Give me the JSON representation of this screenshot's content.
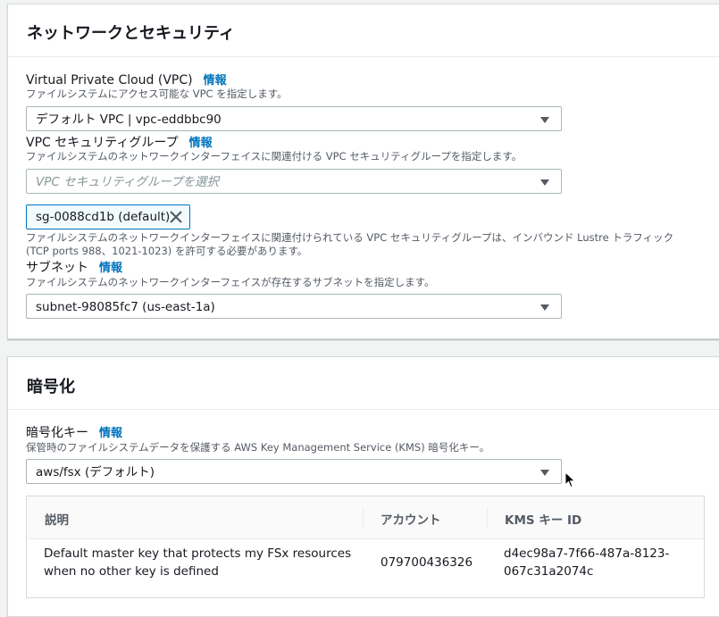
{
  "network": {
    "title": "ネットワークとセキュリティ",
    "vpc": {
      "label": "Virtual Private Cloud (VPC)",
      "info": "情報",
      "description": "ファイルシステムにアクセス可能な VPC を指定します。",
      "value": "デフォルト VPC | vpc-eddbbc90"
    },
    "sg": {
      "label": "VPC セキュリティグループ",
      "info": "情報",
      "description": "ファイルシステムのネットワークインターフェイスに関連付ける VPC セキュリティグループを指定します。",
      "placeholder": "VPC セキュリティグループを選択",
      "token": "sg-0088cd1b (default)",
      "note_line1": "ファイルシステムのネットワークインターフェイスに関連付けられている VPC セキュリティグループは、インバウンド Lustre トラフィック",
      "note_line2": "(TCP ports 988、1021-1023) を許可する必要があります。"
    },
    "subnet": {
      "label": "サブネット",
      "info": "情報",
      "description": "ファイルシステムのネットワークインターフェイスが存在するサブネットを指定します。",
      "value": "subnet-98085fc7 (us-east-1a)"
    }
  },
  "encryption": {
    "title": "暗号化",
    "key": {
      "label": "暗号化キー",
      "info": "情報",
      "description": "保管時のファイルシステムデータを保護する AWS Key Management Service (KMS) 暗号化キー。",
      "value": "aws/fsx (デフォルト)"
    },
    "table": {
      "headers": [
        "説明",
        "アカウント",
        "KMS キー ID"
      ],
      "row": {
        "desc_line1": "Default master key that protects my FSx resources",
        "desc_line2": "when no other key is defined",
        "account": "079700436326",
        "key_line1": "d4ec98a7-7f66-487a-8123-",
        "key_line2": "067c31a2074c"
      }
    }
  },
  "colors": {
    "link": "#0073bb",
    "token_bg": "#f1faff",
    "border": "#aab7b8"
  },
  "icons": {
    "caret": "caret-down-icon",
    "remove": "close-icon",
    "cursor": "mouse-pointer-icon"
  }
}
